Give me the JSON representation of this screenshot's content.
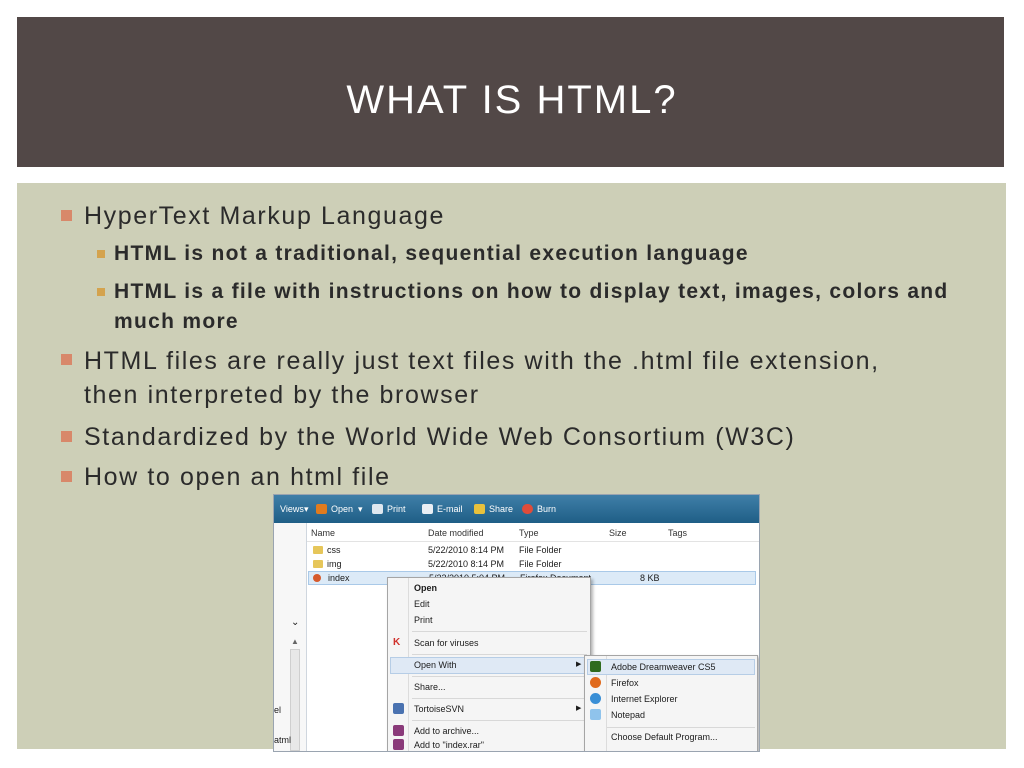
{
  "slide": {
    "title": "WHAT IS HTML?",
    "bullets": [
      "HyperText Markup Language",
      "HTML is not a traditional, sequential execution language",
      "HTML is a file with instructions on how to display text, images, colors and much more",
      "HTML files are really just text files with the .html file extension, then interpreted by the browser",
      "Standardized by the World Wide Web Consortium (W3C)",
      "How to open an html file"
    ]
  },
  "explorer": {
    "toolbar": [
      "Views",
      "Open",
      "Print",
      "E-mail",
      "Share",
      "Burn"
    ],
    "columns": [
      "Name",
      "Date modified",
      "Type",
      "Size",
      "Tags"
    ],
    "rows": [
      {
        "name": "css",
        "date": "5/22/2010 8:14 PM",
        "type": "File Folder",
        "size": ""
      },
      {
        "name": "img",
        "date": "5/22/2010 8:14 PM",
        "type": "File Folder",
        "size": ""
      },
      {
        "name": "index",
        "date": "5/22/2010 5:04 PM",
        "type": "Firefox Document",
        "size": "8 KB"
      }
    ],
    "left_labels": [
      "el",
      "atml"
    ],
    "context_menu": [
      "Open",
      "Edit",
      "Print",
      "Scan for viruses",
      "Open With",
      "Share...",
      "TortoiseSVN",
      "Add to archive...",
      "Add to \"index.rar\""
    ],
    "open_with": [
      "Adobe Dreamweaver CS5",
      "Firefox",
      "Internet Explorer",
      "Notepad",
      "Choose Default Program..."
    ]
  },
  "colors": {
    "title_band": "#524847",
    "content_bg": "#cdcfb7",
    "bullet_l1": "#d8886a",
    "bullet_l2": "#d4a34e"
  }
}
